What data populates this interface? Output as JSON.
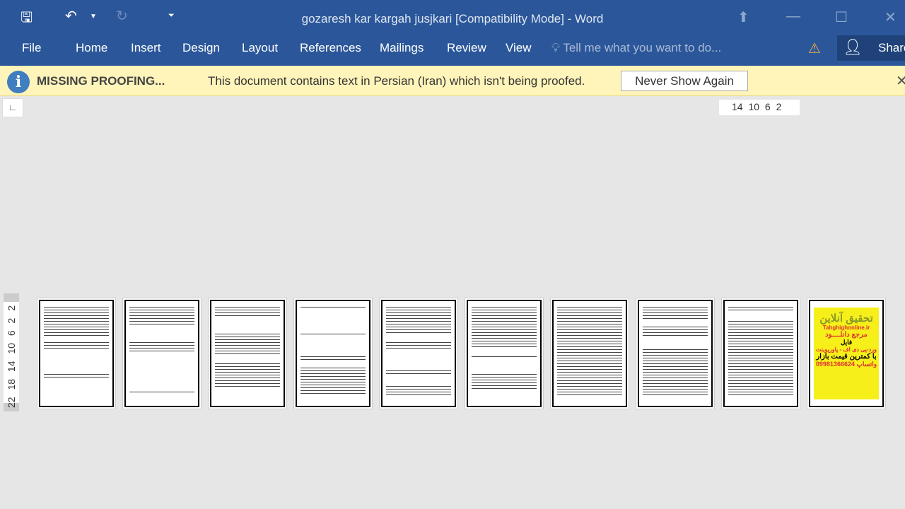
{
  "window": {
    "title": "gozaresh kar kargah jusjkari [Compatibility Mode] - Word"
  },
  "qat": {
    "save_icon": "save-icon",
    "undo_icon": "undo-icon",
    "redo_icon": "redo-icon",
    "customize_icon": "customize-qat-icon"
  },
  "ribbon": {
    "tabs": [
      "File",
      "Home",
      "Insert",
      "Design",
      "Layout",
      "References",
      "Mailings",
      "Review",
      "View"
    ],
    "tell_me": "Tell me what you want to do...",
    "share": "Share"
  },
  "message_bar": {
    "title": "MISSING PROOFING...",
    "text": "This document contains text in Persian (Iran) which isn't being proofed.",
    "button": "Never Show Again"
  },
  "ruler": {
    "horizontal": "14 10 6 2",
    "vertical": "22 18 14 10 6 2 2"
  },
  "ad_page": {
    "title": "تحقیق آنلاین",
    "site": "Tahghighonline.ir",
    "line1": "مرجع دانلــــود",
    "line2": "فایل",
    "line3": "ورد-پی دی اف - پاورپوینت",
    "line4": "با کمترین قیمت بازار",
    "phone": "09981366624",
    "line5": "واتساپ"
  },
  "colors": {
    "accent": "#2b579a",
    "message_bar": "#fff4b9",
    "ad_background": "#f7ef1a"
  }
}
